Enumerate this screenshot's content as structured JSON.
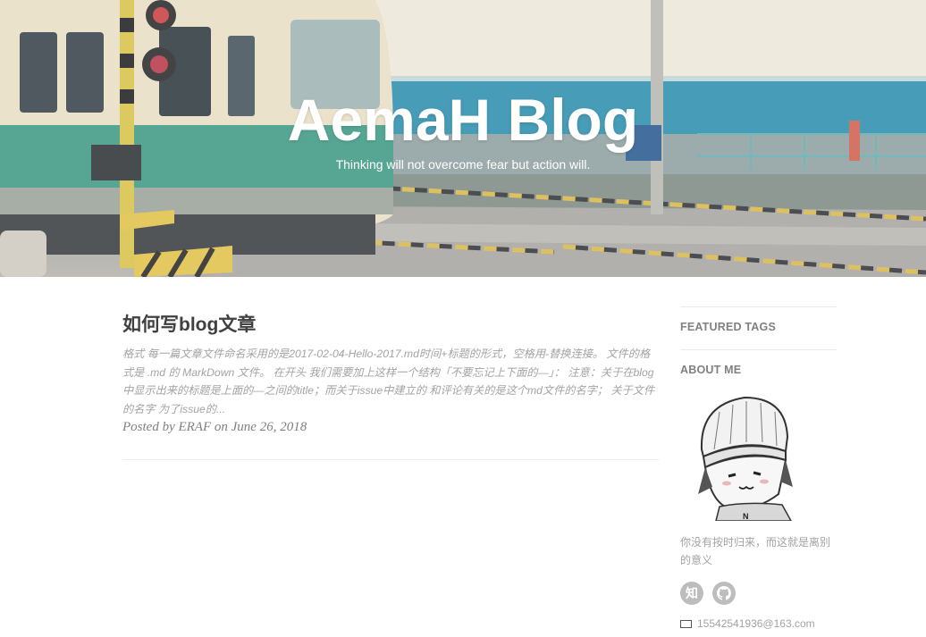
{
  "header": {
    "title": "AemaH Blog",
    "subtitle": "Thinking will not overcome fear but action will."
  },
  "posts": [
    {
      "title": "如何写blog文章",
      "excerpt": "格式 每一篇文章文件命名采用的是2017-02-04-Hello-2017.md时间+标题的形式，空格用-替换连接。 文件的格式是 .md 的 MarkDown 文件。 在开头 我们需要加上这样一个结构「不要忘记上下面的—」： 注意：关于在blog中显示出来的标题是上面的—之间的title；而关于issue中建立的 和评论有关的是这个md文件的名字； 关于文件的名字 为了issue的...",
      "meta": "Posted by ERAF on June 26, 2018"
    }
  ],
  "sidebar": {
    "featured_tags_title": "FEATURED TAGS",
    "about_title": "ABOUT ME",
    "bio": "你没有按时归来，而这就是离别的意义",
    "social": [
      {
        "icon": "zhihu-icon",
        "label": "知"
      },
      {
        "icon": "github-icon",
        "label": ""
      }
    ],
    "email": "15542541936@163.com"
  },
  "colors": {
    "text": "#404040",
    "muted": "#a3a3a3",
    "sidebar_heading": "#808080",
    "social_bg": "#bdbdbd"
  }
}
